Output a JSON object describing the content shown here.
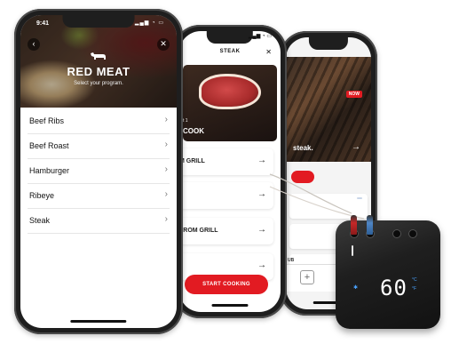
{
  "phone1": {
    "status_time": "9:41",
    "title": "RED MEAT",
    "subtitle": "Select your program.",
    "items": [
      {
        "label": "Beef Ribs"
      },
      {
        "label": "Beef Roast"
      },
      {
        "label": "Hamburger"
      },
      {
        "label": "Ribeye"
      },
      {
        "label": "Steak"
      }
    ]
  },
  "phone2": {
    "header": "STEAK",
    "hero_small": "t 1",
    "hero_title": "COOK",
    "cards": [
      {
        "label": "M GRILL"
      },
      {
        "label": ""
      },
      {
        "label": "FROM GRILL"
      },
      {
        "label": ""
      }
    ],
    "start_button": "START COOKING"
  },
  "phone3": {
    "badge_now": "NOW",
    "hero_text": "steak.",
    "card_badges": [
      "",
      "",
      ""
    ],
    "tab_label": "UB"
  },
  "device": {
    "display": "60"
  },
  "icons": {
    "back": "chevron-left-icon",
    "close": "close-icon",
    "chevron": "chevron-right-icon",
    "arrow": "arrow-right-icon",
    "cow": "cow-icon",
    "plus": "plus-icon"
  },
  "colors": {
    "accent_red": "#e21b22",
    "device_blue": "#4aa3ff"
  }
}
